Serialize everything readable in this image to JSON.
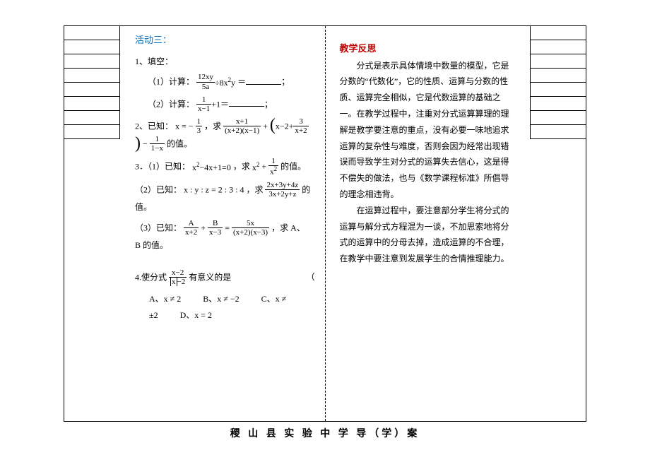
{
  "activity": {
    "title": "活动三：",
    "q1_label": "1、填空：",
    "q1_1_prefix": "（1）计算：",
    "q1_1_suffix": "＝",
    "q1_1_end": "；",
    "q1_1_frac_num": "12xy",
    "q1_1_frac_den": "5a",
    "q1_1_tail": "÷8x",
    "q1_1_tail_sup": "2",
    "q1_1_tail_y": "y",
    "q1_2_prefix": "（2）计算：",
    "q1_2_frac_num": "1",
    "q1_2_frac_den": "x−1",
    "q1_2_plus1": "+1＝",
    "q1_2_end": "；",
    "q2_prefix": "2、已知：",
    "q2_xeq": "x = −",
    "q2_x_num": "1",
    "q2_x_den": "3",
    "q2_comma": "，求",
    "q2_a_num": "x+1",
    "q2_a_den": "(x+2)(x−1)",
    "q2_plus": "+",
    "q2_b_inner_left": "x−2+",
    "q2_b_inner_num": "3",
    "q2_b_inner_den": "x+2",
    "q2_minus": "−",
    "q2_c_num": "1",
    "q2_c_den": "1−x",
    "q2_tail": "的值。",
    "q3_1_prefix": "3．（1）已知：",
    "q3_1_eq": "x",
    "q3_1_eq_sup": "2",
    "q3_1_eq_rest": "−4x+1=0",
    "q3_1_comma": "，求",
    "q3_1_x": "x",
    "q3_1_x_sup": "2",
    "q3_1_plus": "+",
    "q3_1_frac_num": "1",
    "q3_1_frac_den_x": "x",
    "q3_1_frac_den_sup": "2",
    "q3_1_tail": "的值。",
    "q3_2_prefix": "（2）已知：",
    "q3_2_ratio": "x : y : z = 2 : 3 : 4",
    "q3_2_comma": "，求",
    "q3_2_num": "2x+3y+4z",
    "q3_2_den": "3x+2y+z",
    "q3_2_tail": "的值。",
    "q3_3_prefix": "（3）已知：",
    "q3_3_a_num": "A",
    "q3_3_a_den": "x+2",
    "q3_3_plus": "+",
    "q3_3_b_num": "B",
    "q3_3_b_den": "x−3",
    "q3_3_eq": "=",
    "q3_3_c_num": "5x",
    "q3_3_c_den": "(x+2)(x−3)",
    "q3_3_tail": "，求 A、B 的值。",
    "q4_prefix": "4.使分式",
    "q4_num": "x−2",
    "q4_den_abs": "x",
    "q4_den_rest": "−2",
    "q4_tail": "有意义的是",
    "q4_paren": "（",
    "q4_optA": "A、x ≠ 2",
    "q4_optB": "B、x ≠ −2",
    "q4_optC": "C、x ≠ ±2",
    "q4_optD": "D、x = 2"
  },
  "reflection": {
    "title": "教学反思",
    "p1": "分式是表示具体情境中数量的模型，它是分数的“代数化”，它的性质、运算与分数的性质、运算完全相似，它是代数运算的基础之一。在教学过程中，注重对分式运算算理的理解是教学要注意的重点，没有必要一味地追求运算的复杂性与难度，否则会因为经常出现错误而导致学生对分式的运算失去信心，这是得不偿失的做法，也与《数学课程标准》所倡导的理念相违背。",
    "p2": "在运算过程中，要注意部分学生将分式的运算与解分式方程混为一谈，不加思索地将分式的运算中的分母去掉，造成运算的不合理，在教学中要注意到发展学生的合情推理能力。"
  },
  "footer": "稷 山 县 实 验 中 学 导（学）案"
}
